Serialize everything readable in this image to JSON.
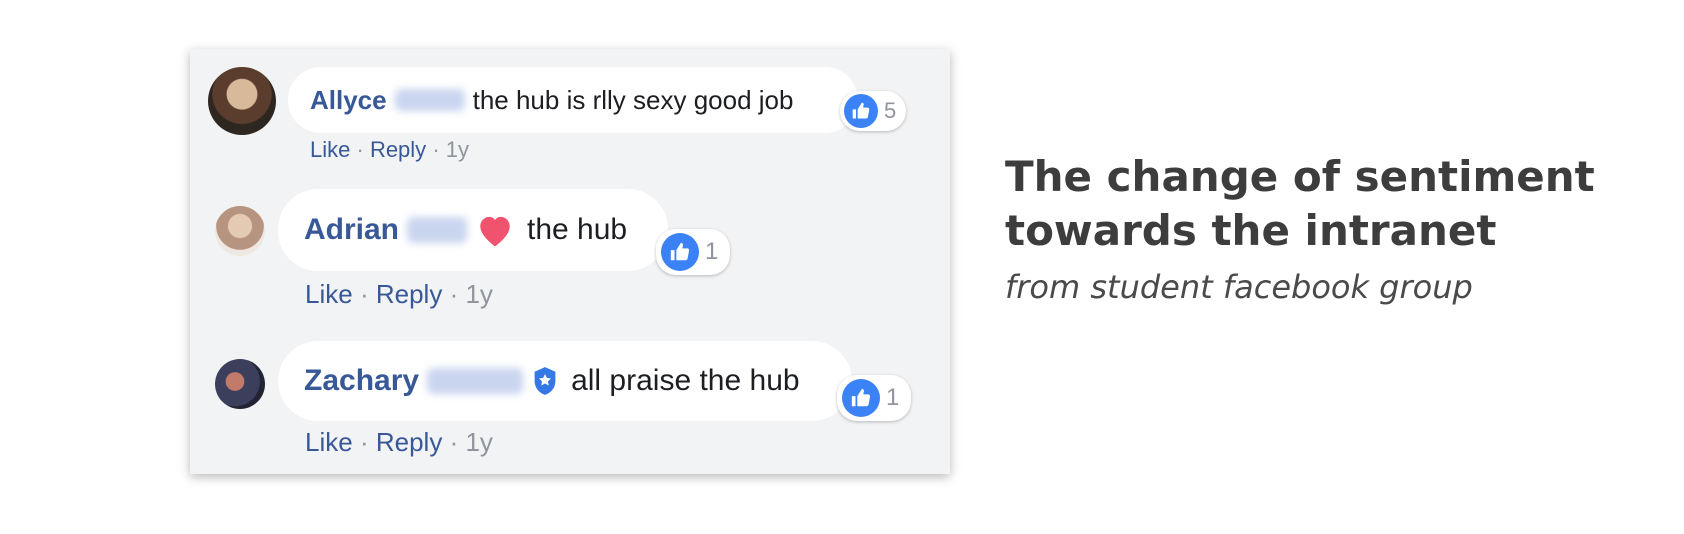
{
  "comments": [
    {
      "author": "Allyce",
      "text": "the hub is rlly sexy good job",
      "reactions": "5",
      "actions": {
        "like": "Like",
        "reply": "Reply",
        "time": "1y"
      }
    },
    {
      "author": "Adrian",
      "text": "the hub",
      "reactions": "1",
      "actions": {
        "like": "Like",
        "reply": "Reply",
        "time": "1y"
      }
    },
    {
      "author": "Zachary",
      "text": "all praise the hub",
      "reactions": "1",
      "actions": {
        "like": "Like",
        "reply": "Reply",
        "time": "1y"
      }
    }
  ],
  "separator": "·",
  "caption": {
    "title": "The change of sentiment towards the intranet",
    "subtitle": "from student facebook group"
  },
  "colors": {
    "author": "#385898",
    "like_blue": "#3b82f6",
    "card_bg": "#f2f3f5",
    "heart": "#f0536d"
  },
  "icons": [
    "thumbs-up-icon",
    "heart-icon",
    "badge-icon"
  ]
}
